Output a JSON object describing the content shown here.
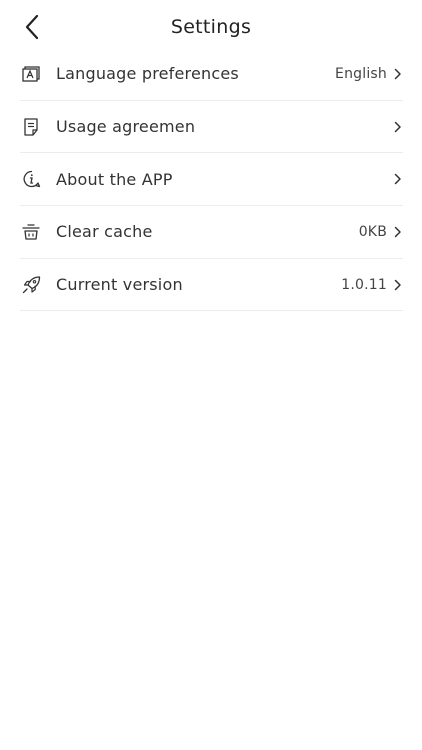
{
  "header": {
    "title": "Settings"
  },
  "items": [
    {
      "label": "Language preferences",
      "value": "English",
      "icon": "language-icon"
    },
    {
      "label": "Usage agreemen",
      "value": "",
      "icon": "document-icon"
    },
    {
      "label": "About the APP",
      "value": "",
      "icon": "info-icon"
    },
    {
      "label": "Clear cache",
      "value": "0KB",
      "icon": "basket-icon"
    },
    {
      "label": "Current version",
      "value": "1.0.11",
      "icon": "rocket-icon"
    }
  ],
  "colors": {
    "text": "#333333",
    "divider": "#ececec",
    "background": "#ffffff"
  }
}
